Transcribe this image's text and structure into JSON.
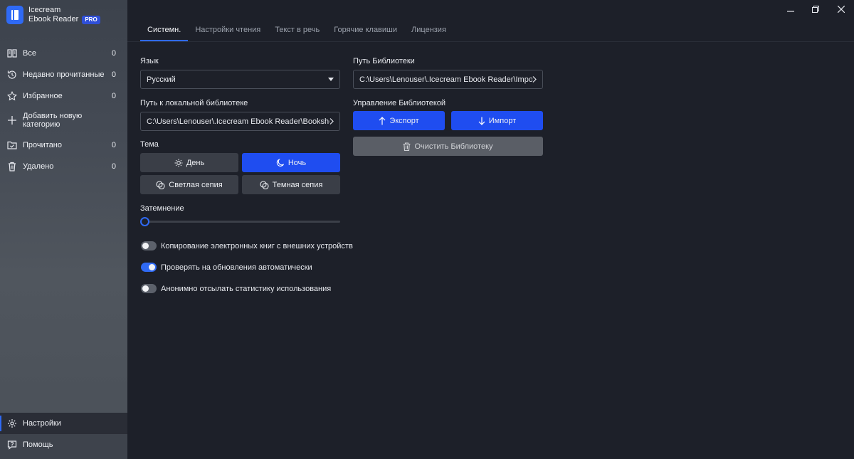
{
  "app": {
    "name_line1": "Icecream",
    "name_line2": "Ebook Reader",
    "badge": "PRO"
  },
  "sidebar": {
    "items": [
      {
        "label": "Все",
        "count": "0",
        "icon": "book-open-icon"
      },
      {
        "label": "Недавно прочитанные",
        "count": "0",
        "icon": "history-icon"
      },
      {
        "label": "Избранное",
        "count": "0",
        "icon": "star-icon"
      },
      {
        "label": "Добавить новую категорию",
        "icon": "plus-icon"
      },
      {
        "label": "Прочитано",
        "count": "0",
        "icon": "folder-check-icon"
      },
      {
        "label": "Удалено",
        "count": "0",
        "icon": "trash-icon"
      }
    ],
    "settings_label": "Настройки",
    "help_label": "Помощь"
  },
  "tabs": [
    "Системн.",
    "Настройки чтения",
    "Текст в речь",
    "Горячие клавиши",
    "Лицензия"
  ],
  "left": {
    "language_label": "Язык",
    "language_value": "Русский",
    "local_library_label": "Путь к локальной библиотеке",
    "local_library_path": "C:\\Users\\Lenouser\\.Icecream Ebook Reader\\Bookshelf",
    "theme_label": "Тема",
    "themes": {
      "day": "День",
      "night": "Ночь",
      "light_sepia": "Светлая сепия",
      "dark_sepia": "Темная сепия"
    },
    "dimming_label": "Затемнение",
    "dimming_value": 0,
    "toggles": [
      {
        "label": "Копирование электронных книг с внешних устройств",
        "on": false
      },
      {
        "label": "Проверять на обновления автоматически",
        "on": true
      },
      {
        "label": "Анонимно отсылать статистику использования",
        "on": false
      }
    ]
  },
  "right": {
    "library_path_label": "Путь Библиотеки",
    "library_path": "C:\\Users\\Lenouser\\.Icecream Ebook Reader\\Import",
    "management_label": "Управление Библиотекой",
    "export_label": "Экспорт",
    "import_label": "Импорт",
    "clear_label": "Очистить Библиотеку"
  },
  "colors": {
    "accent": "#1f4df0",
    "background": "#1d2029",
    "sidebar": "#454b55"
  }
}
